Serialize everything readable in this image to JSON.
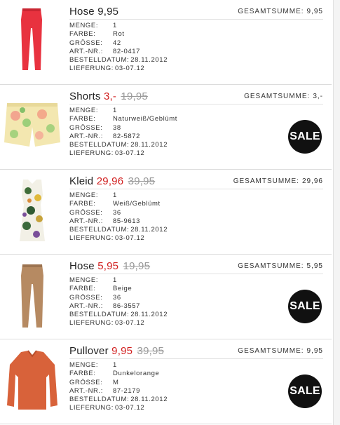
{
  "total_label": "GESAMTSUMME:",
  "labels": {
    "menge": "MENGE:",
    "farbe": "FARBE:",
    "groesse": "GRÖSSE:",
    "artnr": "ART.-NR.:",
    "bestelldatum": "BESTELLDATUM:",
    "lieferung": "LIEFERUNG:"
  },
  "sale_text": "SALE",
  "items": [
    {
      "name": "Hose",
      "price": "9,95",
      "old_price": "",
      "total": "9,95",
      "menge": "1",
      "farbe": "Rot",
      "groesse": "42",
      "artnr": "82-0417",
      "bestelldatum": "28.11.2012",
      "lieferung": "03-07.12",
      "image_icon": "red-trousers-image",
      "color": "#e8323f"
    },
    {
      "name": "Shorts",
      "price": "3,-",
      "old_price": "19,95",
      "total": "3,-",
      "menge": "1",
      "farbe": "Naturweiß/Geblümt",
      "groesse": "38",
      "artnr": "82-5872",
      "bestelldatum": "28.11.2012",
      "lieferung": "03-07.12",
      "image_icon": "floral-shorts-image",
      "color": "#f3e7b0"
    },
    {
      "name": "Kleid",
      "price": "29,96",
      "old_price": "39,95",
      "total": "29,96",
      "menge": "1",
      "farbe": "Weiß/Geblümt",
      "groesse": "36",
      "artnr": "85-9613",
      "bestelldatum": "28.11.2012",
      "lieferung": "03-07.12",
      "image_icon": "floral-dress-image",
      "color": "#f2f0e6"
    },
    {
      "name": "Hose",
      "price": "5,95",
      "old_price": "19,95",
      "total": "5,95",
      "menge": "1",
      "farbe": "Beige",
      "groesse": "36",
      "artnr": "86-3557",
      "bestelldatum": "28.11.2012",
      "lieferung": "03-07.12",
      "image_icon": "beige-trousers-image",
      "color": "#b68a62"
    },
    {
      "name": "Pullover",
      "price": "9,95",
      "old_price": "39,95",
      "total": "9,95",
      "menge": "1",
      "farbe": "Dunkelorange",
      "groesse": "M",
      "artnr": "87-2179",
      "bestelldatum": "28.11.2012",
      "lieferung": "03-07.12",
      "image_icon": "orange-sweater-image",
      "color": "#d8623a"
    }
  ]
}
